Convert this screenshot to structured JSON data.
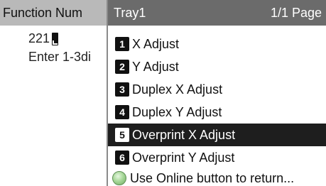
{
  "background": {
    "header_text": "Function Num",
    "value": "221",
    "hint": "Enter 1-3di"
  },
  "menu": {
    "title": "Tray1",
    "page": "1/1 Page",
    "items": [
      {
        "num": "1",
        "label": "X Adjust",
        "selected": false
      },
      {
        "num": "2",
        "label": "Y Adjust",
        "selected": false
      },
      {
        "num": "3",
        "label": "Duplex X Adjust",
        "selected": false
      },
      {
        "num": "4",
        "label": "Duplex Y Adjust",
        "selected": false
      },
      {
        "num": "5",
        "label": "Overprint X Adjust",
        "selected": true
      },
      {
        "num": "6",
        "label": "Overprint Y Adjust",
        "selected": false
      }
    ],
    "footer_text": "Use Online button to return..."
  },
  "colors": {
    "menu_header_bg": "#6b6b6b",
    "selected_bg": "#1e1e1e",
    "bg_header": "#b9b9b9",
    "online_icon": "#a8d89a"
  },
  "icons": {
    "enter": "enter-icon",
    "online": "online-button-icon"
  }
}
